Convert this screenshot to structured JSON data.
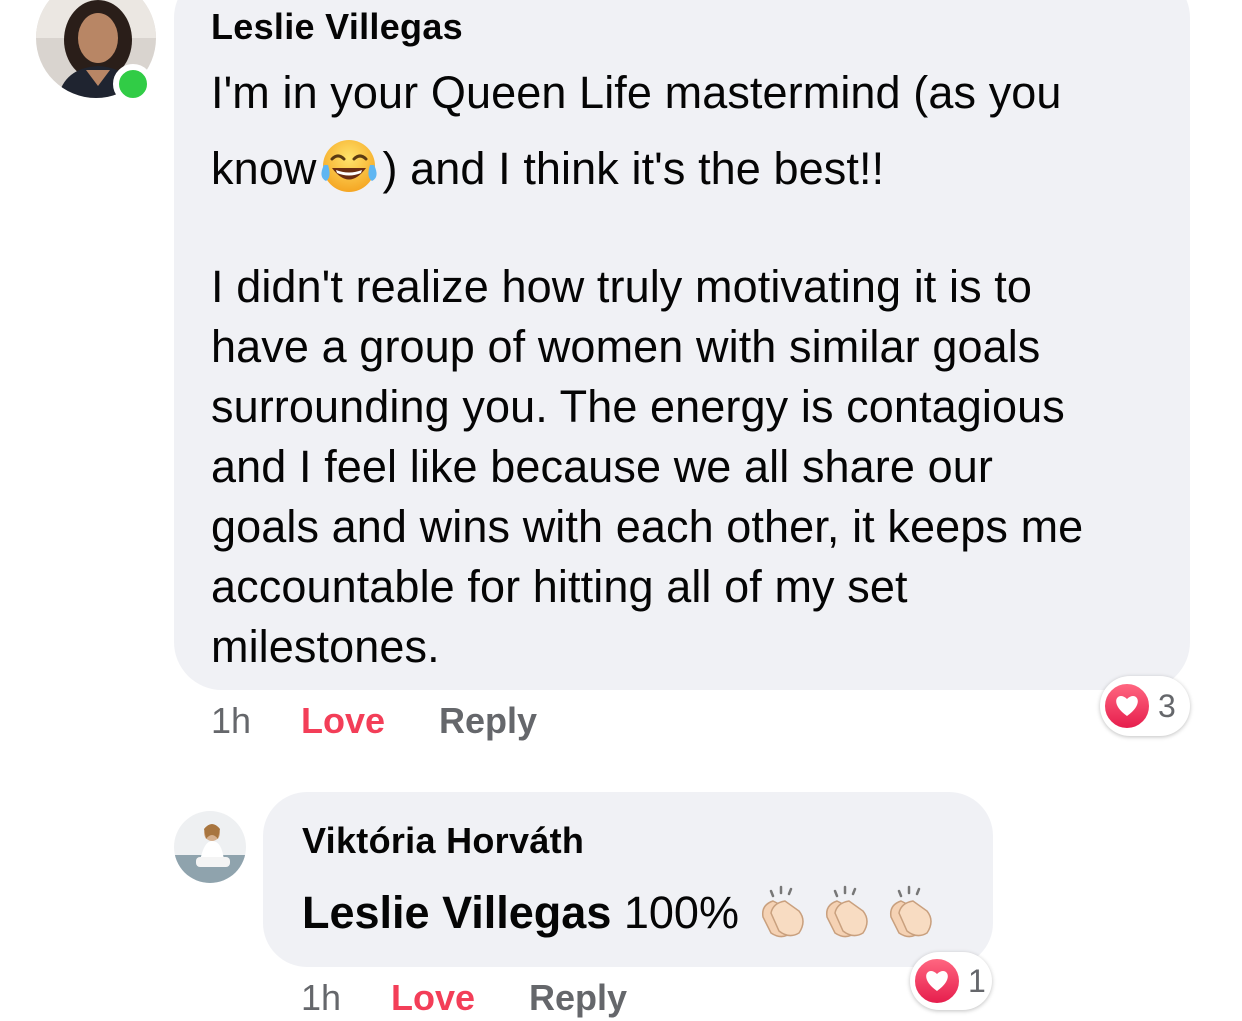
{
  "comments": [
    {
      "author": "Leslie Villegas",
      "online": true,
      "text_lines": [
        "I'm in your Queen Life mastermind (as you",
        "know",
        ") and I think it's the best!!",
        "",
        "I didn't realize how truly motivating it is to",
        "have a group of women with similar goals",
        "surrounding you. The energy is contagious",
        "and I feel like because we all share our",
        "goals and wins with each other, it keeps me",
        "accountable for hitting all of my set",
        "milestones."
      ],
      "inline_emoji": "face-with-tears-of-joy-icon",
      "time": "1h",
      "love_label": "Love",
      "reply_label": "Reply",
      "reaction": {
        "icon": "heart-icon",
        "count": "3"
      }
    },
    {
      "author": "Viktória Horváth",
      "mention": "Leslie Villegas",
      "text": " 100% ",
      "emojis": [
        "clapping-hands-icon",
        "clapping-hands-icon",
        "clapping-hands-icon"
      ],
      "time": "1h",
      "love_label": "Love",
      "reply_label": "Reply",
      "reaction": {
        "icon": "heart-icon",
        "count": "1"
      }
    }
  ],
  "colors": {
    "bubble": "#f0f1f5",
    "love": "#f33e58",
    "meta": "#65676b",
    "online": "#31cc46"
  }
}
